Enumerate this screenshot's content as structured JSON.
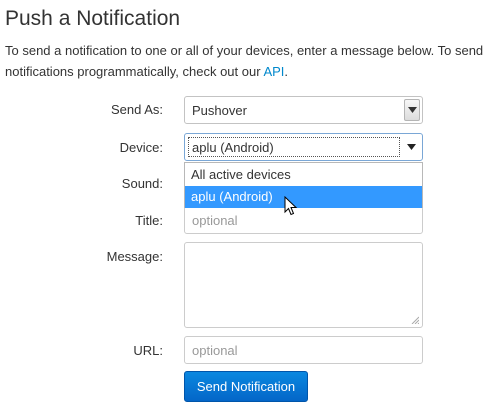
{
  "page": {
    "title": "Push a Notification",
    "intro_text": "To send a notification to one or all of your devices, enter a message below. To send notifications programmatically, check out our ",
    "intro_link": "API",
    "intro_end": "."
  },
  "form": {
    "send_as": {
      "label": "Send As:",
      "value": "Pushover"
    },
    "device": {
      "label": "Device:",
      "value": "aplu (Android)",
      "options": [
        "All active devices",
        "aplu (Android)"
      ],
      "highlighted": "aplu (Android)"
    },
    "sound": {
      "label": "Sound:"
    },
    "title": {
      "label": "Title:",
      "placeholder": "optional"
    },
    "message": {
      "label": "Message:"
    },
    "url": {
      "label": "URL:",
      "placeholder": "optional"
    },
    "submit_label": "Send Notification"
  },
  "colors": {
    "accent": "#0088cc",
    "button": "#0466c8",
    "highlight": "#3399ff"
  },
  "icons": [
    "chevron-down-icon",
    "resize-grip-icon",
    "mouse-pointer-icon"
  ]
}
